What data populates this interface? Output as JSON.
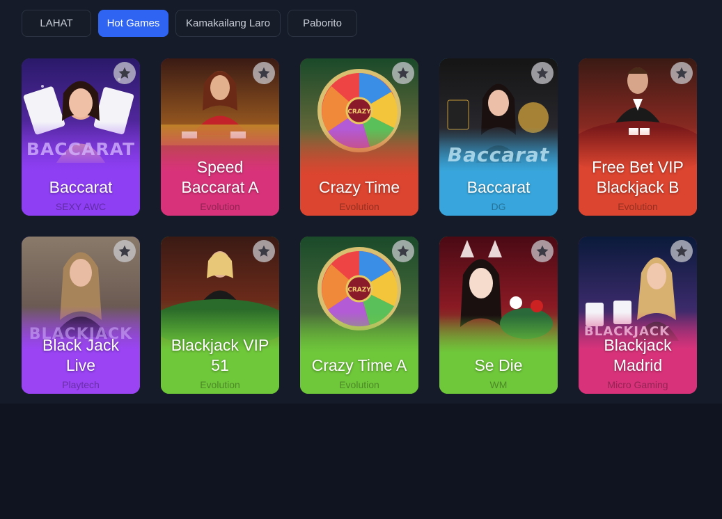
{
  "tabs": [
    {
      "label": "LAHAT",
      "active": false
    },
    {
      "label": "Hot Games",
      "active": true
    },
    {
      "label": "Kamakailang Laro",
      "active": false
    },
    {
      "label": "Paborito",
      "active": false
    }
  ],
  "games": [
    {
      "title": "Baccarat",
      "provider": "SEXY AWC",
      "bottom_color": "#8e3ff4",
      "art_text": "BACCARAT"
    },
    {
      "title": "Speed Baccarat A",
      "provider": "Evolution",
      "bottom_color": "#d8337a",
      "art_text": ""
    },
    {
      "title": "Crazy Time",
      "provider": "Evolution",
      "bottom_color": "#dc4530",
      "art_text": ""
    },
    {
      "title": "Baccarat",
      "provider": "DG",
      "bottom_color": "#38a6dc",
      "art_text": "Baccarat"
    },
    {
      "title": "Free Bet VIP Blackjack B",
      "provider": "Evolution",
      "bottom_color": "#dc4530",
      "art_text": ""
    },
    {
      "title": "Black Jack Live",
      "provider": "Playtech",
      "bottom_color": "#9a44f4",
      "art_text": "BLACKJACK"
    },
    {
      "title": "Blackjack VIP 51",
      "provider": "Evolution",
      "bottom_color": "#6fc83a",
      "art_text": ""
    },
    {
      "title": "Crazy Time A",
      "provider": "Evolution",
      "bottom_color": "#6fc83a",
      "art_text": ""
    },
    {
      "title": "Se Die",
      "provider": "WM",
      "bottom_color": "#6fc83a",
      "art_text": ""
    },
    {
      "title": "Blackjack Madrid",
      "provider": "Micro Gaming",
      "bottom_color": "#d8337a",
      "art_text": "BLACKJACK"
    }
  ]
}
